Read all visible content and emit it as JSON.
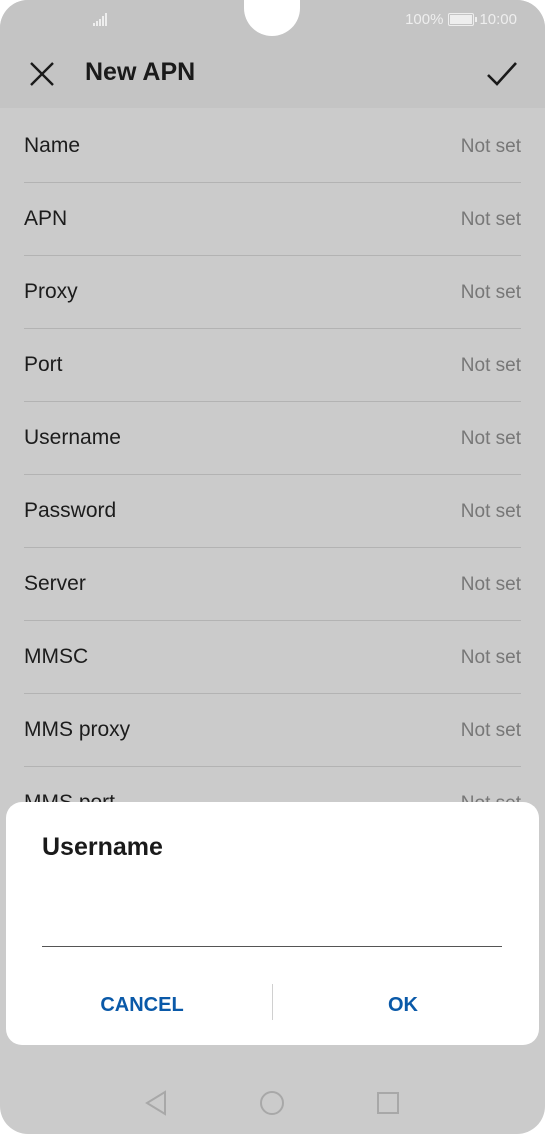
{
  "status_bar": {
    "battery_text": "100%",
    "time": "10:00"
  },
  "header": {
    "title": "New APN",
    "close_icon": "close-icon",
    "confirm_icon": "check-icon"
  },
  "fields": [
    {
      "label": "Name",
      "value": "Not set"
    },
    {
      "label": "APN",
      "value": "Not set"
    },
    {
      "label": "Proxy",
      "value": "Not set"
    },
    {
      "label": "Port",
      "value": "Not set"
    },
    {
      "label": "Username",
      "value": "Not set"
    },
    {
      "label": "Password",
      "value": "Not set"
    },
    {
      "label": "Server",
      "value": "Not set"
    },
    {
      "label": "MMSC",
      "value": "Not set"
    },
    {
      "label": "MMS proxy",
      "value": "Not set"
    },
    {
      "label": "MMS port",
      "value": "Not set"
    }
  ],
  "dialog": {
    "title": "Username",
    "input_value": "",
    "cancel_label": "CANCEL",
    "ok_label": "OK"
  },
  "navbar": {
    "back_icon": "back-triangle-icon",
    "home_icon": "home-circle-icon",
    "recents_icon": "recents-square-icon"
  },
  "colors": {
    "accent": "#0a59a8",
    "overlay_background": "#cbcbcb",
    "dialog_background": "#ffffff"
  }
}
